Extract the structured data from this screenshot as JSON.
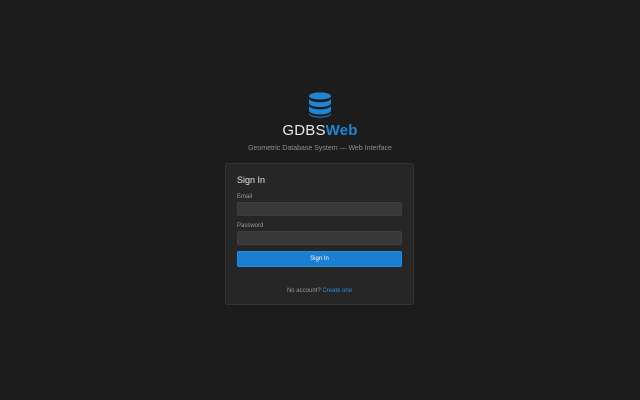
{
  "brand": {
    "title_main": "GDBS",
    "title_accent": "Web",
    "subtitle": "Geometric Database System — Web Interface",
    "logo_icon": "database-icon",
    "accent_color": "#1f86d6"
  },
  "signin_card": {
    "title": "Sign In",
    "email_label": "Email",
    "email_value": "",
    "password_label": "Password",
    "password_value": "",
    "submit_label": "Sign In",
    "footer_prompt": "No account?",
    "footer_link": "Create one"
  },
  "colors": {
    "background": "#1c1c1c",
    "card": "#262626",
    "input": "#383838",
    "button": "#1a7fd0",
    "link": "#2a8ee0"
  }
}
